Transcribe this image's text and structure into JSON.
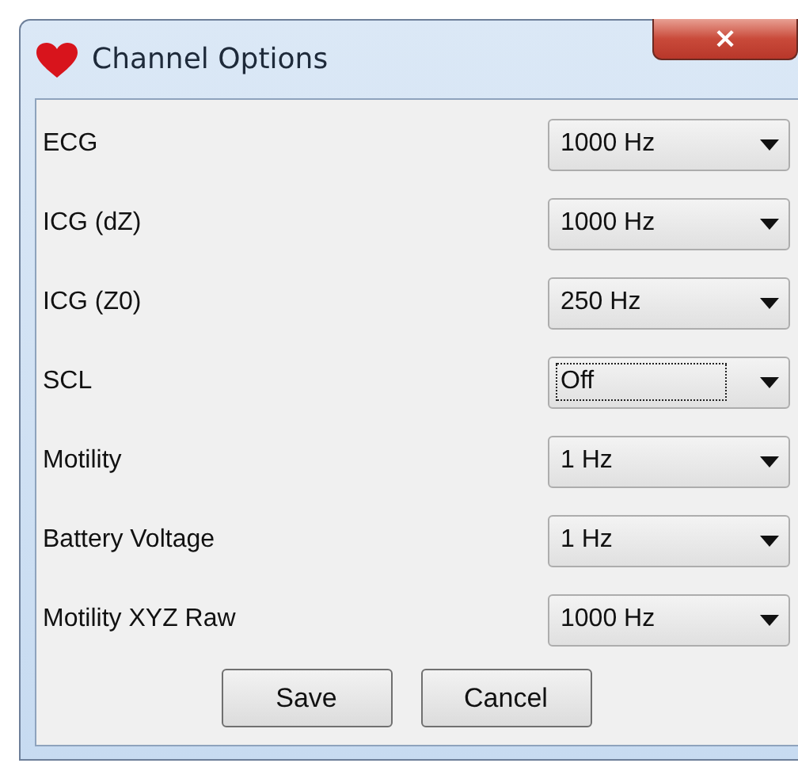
{
  "window": {
    "title": "Channel Options",
    "close": "×"
  },
  "channels": [
    {
      "name": "ECG",
      "value": "1000 Hz",
      "focused": false
    },
    {
      "name": "ICG (dZ)",
      "value": "1000 Hz",
      "focused": false
    },
    {
      "name": "ICG (Z0)",
      "value": "250 Hz",
      "focused": false
    },
    {
      "name": "SCL",
      "value": "Off",
      "focused": true
    },
    {
      "name": "Motility",
      "value": "1 Hz",
      "focused": false
    },
    {
      "name": "Battery Voltage",
      "value": "1 Hz",
      "focused": false
    },
    {
      "name": "Motility XYZ Raw",
      "value": "1000 Hz",
      "focused": false
    }
  ],
  "buttons": [
    "Save",
    "Cancel"
  ]
}
